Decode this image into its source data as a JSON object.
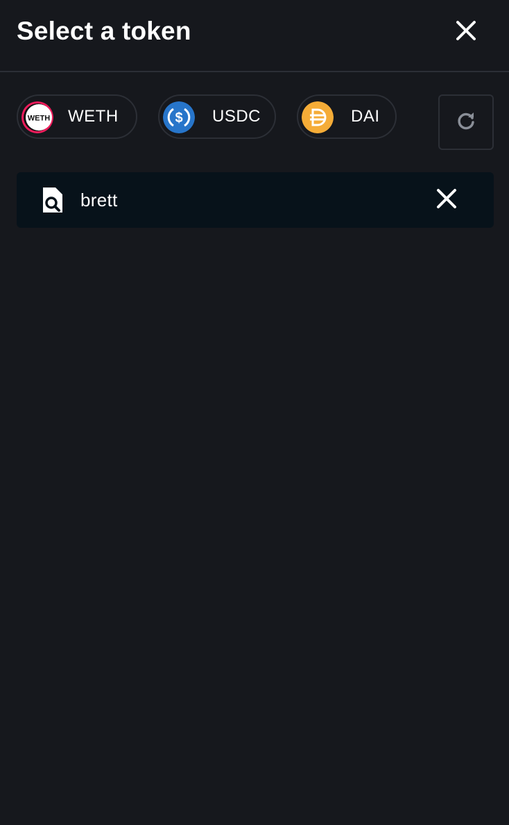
{
  "header": {
    "title": "Select a token",
    "close_icon": "close-icon"
  },
  "common_tokens": [
    {
      "symbol": "WETH",
      "icon": "weth-token-icon",
      "color": "#ec1c5b"
    },
    {
      "symbol": "USDC",
      "icon": "usdc-token-icon",
      "color": "#2775ca"
    },
    {
      "symbol": "DAI",
      "icon": "dai-token-icon",
      "color": "#f5ac37"
    }
  ],
  "refresh": {
    "icon": "refresh-icon"
  },
  "search": {
    "value": "brett",
    "icon": "search-document-icon",
    "clear_icon": "clear-icon"
  },
  "colors": {
    "background": "#16181d",
    "border": "#2c2f36",
    "search_background": "#07121a",
    "text": "#ffffff",
    "muted_icon": "#8a8f98"
  }
}
